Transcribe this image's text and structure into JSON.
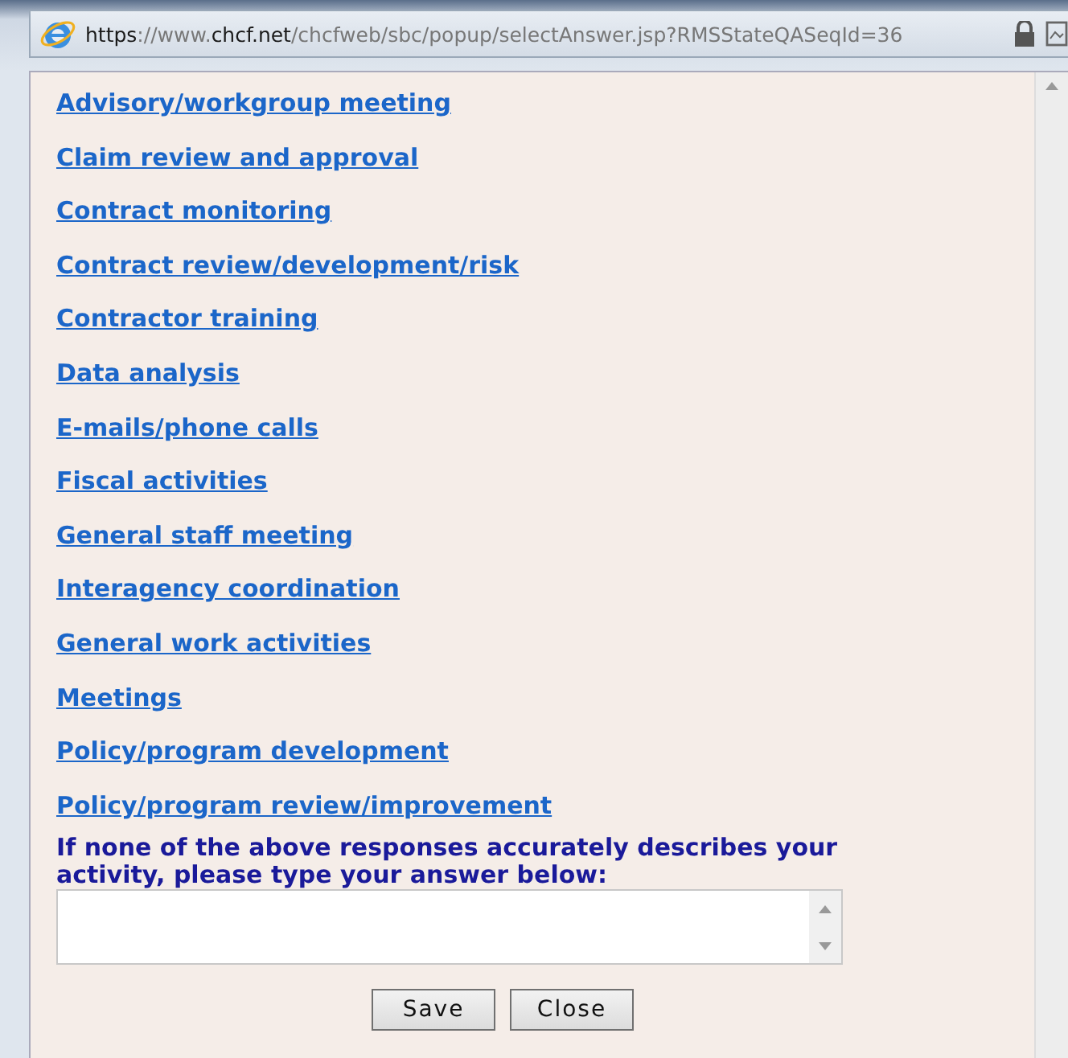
{
  "address_bar": {
    "url": "**https**://www.**chcf.net**/chcfweb/sbc/popup/selectAnswer.jsp?RMSStateQASeqId=36"
  },
  "answers": [
    "Advisory/workgroup meeting",
    "Claim review and approval",
    "Contract monitoring",
    "Contract review/development/risk",
    "Contractor training",
    "Data analysis",
    "E-mails/phone calls",
    "Fiscal activities",
    "General staff meeting",
    "Interagency coordination",
    "General work activities",
    "Meetings",
    "Policy/program development",
    "Policy/program review/improvement"
  ],
  "prompt": "If none of the above responses accurately describes your activity, please type your answer below:",
  "buttons": [
    "Save",
    "Close"
  ]
}
